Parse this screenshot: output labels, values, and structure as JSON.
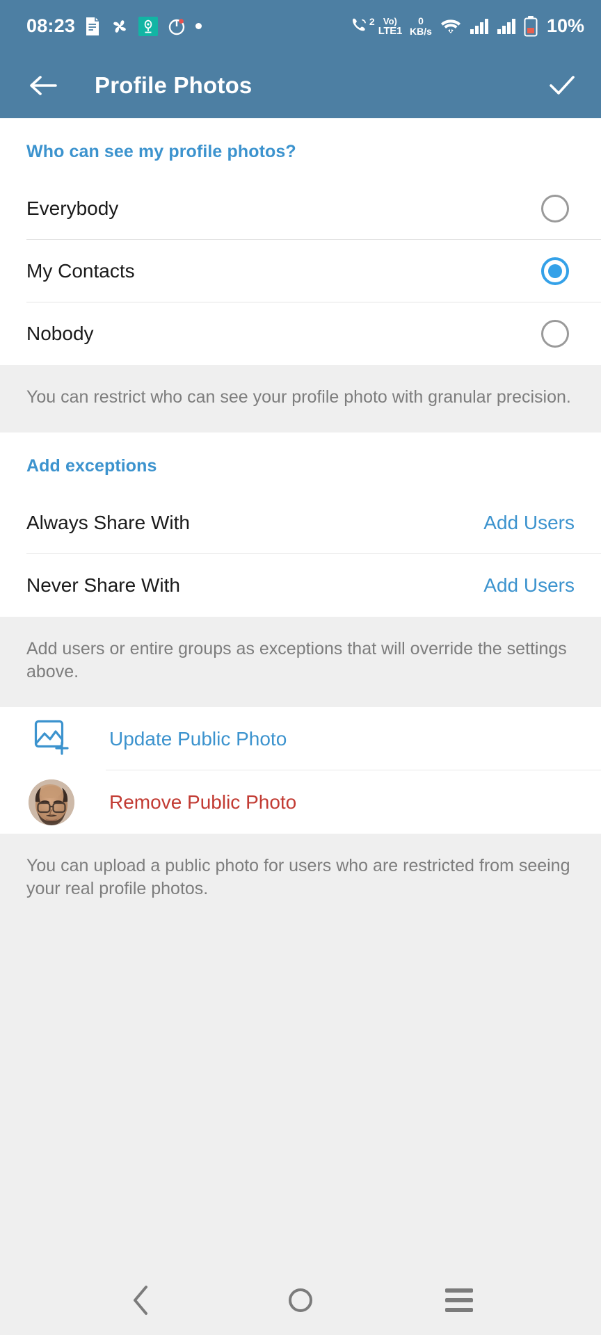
{
  "status_bar": {
    "time": "08:23",
    "icons_left": [
      "document-icon",
      "fan-icon",
      "camera-badge-icon",
      "power-timer-icon",
      "dot-icon"
    ],
    "call_badge": "2",
    "volte_top": "Vo)",
    "volte_bottom": "LTE1",
    "net_speed_value": "0",
    "net_speed_unit": "KB/s",
    "icons_right": [
      "wifi-icon",
      "signal-icon",
      "signal-icon",
      "battery-icon"
    ],
    "battery_percent": "10%"
  },
  "app_bar": {
    "back_icon": "arrow-left-icon",
    "title": "Profile Photos",
    "done_icon": "check-icon"
  },
  "visibility": {
    "section_title": "Who can see my profile photos?",
    "options": [
      {
        "label": "Everybody",
        "selected": false
      },
      {
        "label": "My Contacts",
        "selected": true
      },
      {
        "label": "Nobody",
        "selected": false
      }
    ],
    "note": "You can restrict who can see your profile photo with granular precision."
  },
  "exceptions": {
    "section_title": "Add exceptions",
    "rows": [
      {
        "label": "Always Share With",
        "action": "Add Users"
      },
      {
        "label": "Never Share With",
        "action": "Add Users"
      }
    ],
    "note": "Add users or entire groups as exceptions that will override the settings above."
  },
  "public_photo": {
    "update_label": "Update Public Photo",
    "update_icon": "add-photo-icon",
    "remove_label": "Remove Public Photo",
    "remove_icon": "avatar-photo",
    "note": "You can upload a public photo for users who are restricted from seeing your real profile photos."
  },
  "nav_bar": {
    "back_icon": "chevron-left-icon",
    "home_icon": "circle-icon",
    "recents_icon": "hamburger-icon"
  },
  "colors": {
    "appbar": "#4d7fa3",
    "accent_blue": "#3c93ce",
    "radio_on": "#34a1e8",
    "danger_red": "#c23b33",
    "note_bg": "#efefef",
    "note_text": "#7d7d7d"
  }
}
